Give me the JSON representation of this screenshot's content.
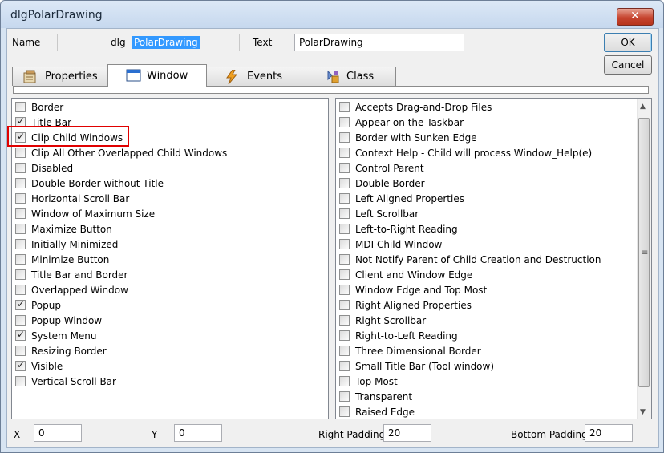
{
  "window": {
    "title": "dlgPolarDrawing",
    "close_glyph": "✕"
  },
  "header": {
    "name_label": "Name",
    "name_prefix": "dlg",
    "name_value": "PolarDrawing",
    "text_label": "Text",
    "text_value": "PolarDrawing",
    "ok_label": "OK",
    "cancel_label": "Cancel"
  },
  "tabs": [
    {
      "label": "Properties",
      "icon": "properties-icon",
      "active": false
    },
    {
      "label": "Window",
      "icon": "window-icon",
      "active": true
    },
    {
      "label": "Events",
      "icon": "lightning-icon",
      "active": false
    },
    {
      "label": "Class",
      "icon": "class-icon",
      "active": false
    }
  ],
  "left_styles": [
    {
      "label": "Border",
      "checked": false
    },
    {
      "label": "Title Bar",
      "checked": true
    },
    {
      "label": "Clip Child Windows",
      "checked": true
    },
    {
      "label": "Clip All Other Overlapped Child Windows",
      "checked": false
    },
    {
      "label": "Disabled",
      "checked": false
    },
    {
      "label": "Double Border without Title",
      "checked": false
    },
    {
      "label": "Horizontal Scroll Bar",
      "checked": false
    },
    {
      "label": "Window of Maximum Size",
      "checked": false
    },
    {
      "label": "Maximize Button",
      "checked": false
    },
    {
      "label": "Initially Minimized",
      "checked": false
    },
    {
      "label": "Minimize Button",
      "checked": false
    },
    {
      "label": "Title Bar and Border",
      "checked": false
    },
    {
      "label": "Overlapped Window",
      "checked": false
    },
    {
      "label": "Popup",
      "checked": true
    },
    {
      "label": "Popup Window",
      "checked": false
    },
    {
      "label": "System Menu",
      "checked": true
    },
    {
      "label": "Resizing Border",
      "checked": false
    },
    {
      "label": "Visible",
      "checked": true
    },
    {
      "label": "Vertical Scroll Bar",
      "checked": false
    }
  ],
  "right_styles": [
    {
      "label": "Accepts Drag-and-Drop Files",
      "checked": false
    },
    {
      "label": "Appear on the Taskbar",
      "checked": false
    },
    {
      "label": "Border with Sunken Edge",
      "checked": false
    },
    {
      "label": "Context Help - Child will process Window_Help(e)",
      "checked": false
    },
    {
      "label": "Control Parent",
      "checked": false
    },
    {
      "label": "Double Border",
      "checked": false
    },
    {
      "label": "Left Aligned Properties",
      "checked": false
    },
    {
      "label": "Left Scrollbar",
      "checked": false
    },
    {
      "label": "Left-to-Right Reading",
      "checked": false
    },
    {
      "label": "MDI Child Window",
      "checked": false
    },
    {
      "label": "Not Notify Parent of Child Creation and Destruction",
      "checked": false
    },
    {
      "label": "Client and Window Edge",
      "checked": false
    },
    {
      "label": "Window Edge and Top Most",
      "checked": false
    },
    {
      "label": "Right Aligned Properties",
      "checked": false
    },
    {
      "label": "Right Scrollbar",
      "checked": false
    },
    {
      "label": "Right-to-Left Reading",
      "checked": false
    },
    {
      "label": "Three Dimensional Border",
      "checked": false
    },
    {
      "label": "Small Title Bar (Tool window)",
      "checked": false
    },
    {
      "label": "Top Most",
      "checked": false
    },
    {
      "label": "Transparent",
      "checked": false
    },
    {
      "label": "Raised Edge",
      "checked": false
    }
  ],
  "footer": {
    "x_label": "X",
    "x_value": "0",
    "y_label": "Y",
    "y_value": "0",
    "right_padding_label": "Right Padding",
    "right_padding_value": "20",
    "bottom_padding_label": "Bottom Padding",
    "bottom_padding_value": "20"
  },
  "colors": {
    "highlight": "#e00000",
    "selection": "#3399ff"
  }
}
